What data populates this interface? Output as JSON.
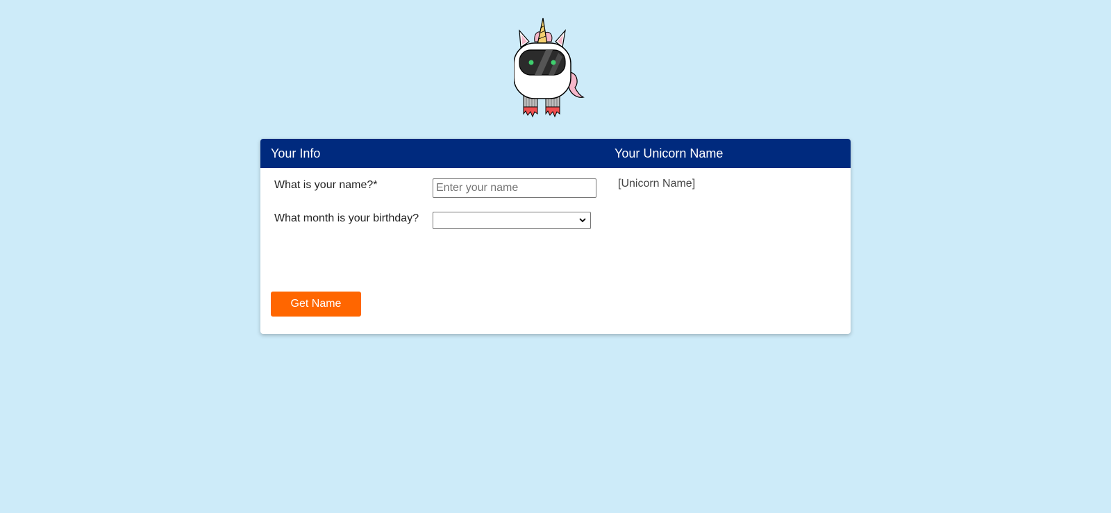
{
  "colors": {
    "page_bg": "#cdebf9",
    "header_bg": "#002a7e",
    "button_bg": "#ff6600"
  },
  "mascot": {
    "icon": "unicorn-robot-icon"
  },
  "card": {
    "header_left": "Your Info",
    "header_right": "Your Unicorn Name"
  },
  "form": {
    "name_label": "What is your name?*",
    "name_placeholder": "Enter your name",
    "name_value": "",
    "month_label": "What month is your birthday?",
    "month_selected": "",
    "submit_label": "Get Name"
  },
  "result": {
    "unicorn_name": "[Unicorn Name]"
  }
}
